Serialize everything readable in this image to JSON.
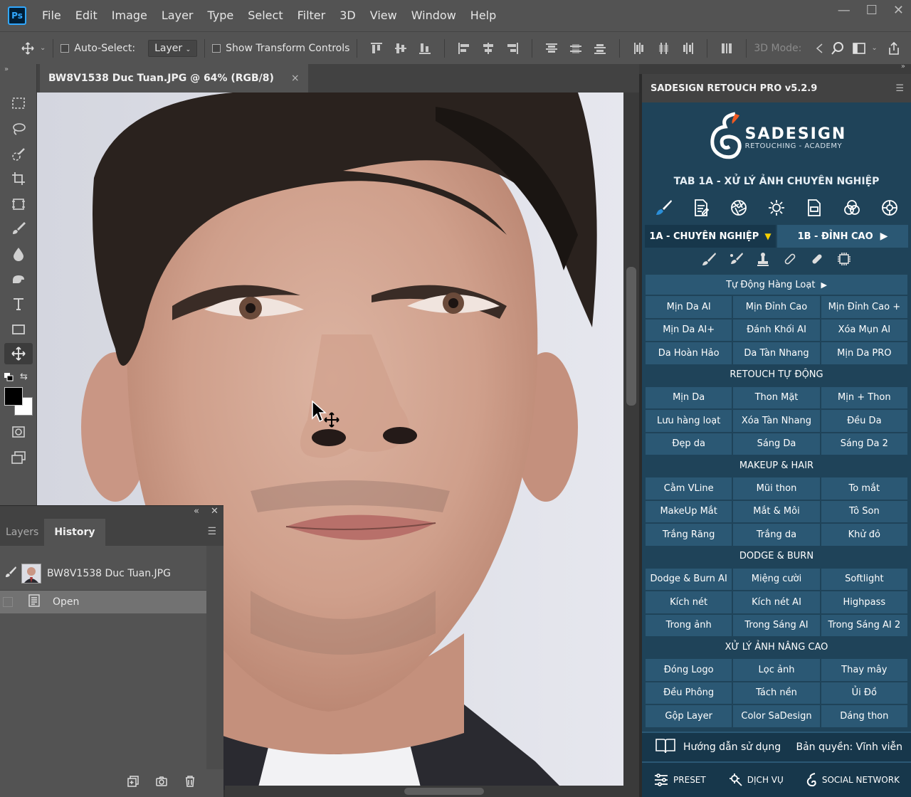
{
  "app": {
    "logo": "Ps"
  },
  "menu": [
    "File",
    "Edit",
    "Image",
    "Layer",
    "Type",
    "Select",
    "Filter",
    "3D",
    "View",
    "Window",
    "Help"
  ],
  "window_controls": {
    "minimize": "—",
    "restore": "☐",
    "close": "✕"
  },
  "options": {
    "auto_select_label": "Auto-Select:",
    "auto_select_value": "Layer",
    "show_transform_label": "Show Transform Controls",
    "mode_3d_label": "3D Mode:"
  },
  "document": {
    "tab_title": "BW8V1538 Duc Tuan.JPG @ 64% (RGB/8)",
    "close_glyph": "×"
  },
  "history_panel": {
    "tab_layers": "Layers",
    "tab_history": "History",
    "snapshot_name": "BW8V1538 Duc Tuan.JPG",
    "states": [
      "Open"
    ]
  },
  "plugin": {
    "header": "SADESIGN RETOUCH PRO v5.2.9",
    "brand_name": "SADESIGN",
    "brand_sub": "RETOUCHING - ACADEMY",
    "tab_title": "TAB 1A - XỬ LÝ ẢNH CHUYÊN NGHIỆP",
    "subtab_1": "1A - CHUYÊN NGHIỆP",
    "subtab_2": "1B - ĐỈNH CAO",
    "auto_batch": "Tự Động Hàng Loạt",
    "row_group_1": [
      "Mịn Da AI",
      "Mịn Đỉnh Cao",
      "Mịn Đỉnh Cao +",
      "Mịn Da AI+",
      "Đánh Khối AI",
      "Xóa Mụn AI",
      "Da Hoàn Hảo",
      "Da Tàn Nhang",
      "Mịn Da PRO"
    ],
    "section_1": "RETOUCH TỰ ĐỘNG",
    "row_group_2": [
      "Mịn Da",
      "Thon Mặt",
      "Mịn + Thon",
      "Lưu hàng loạt",
      "Xóa Tàn Nhang",
      "Đều Da",
      "Đẹp da",
      "Sáng Da",
      "Sáng Da 2"
    ],
    "section_2": "MAKEUP & HAIR",
    "row_group_3": [
      "Cằm VLine",
      "Mũi thon",
      "To mắt",
      "MakeUp Mắt",
      "Mắt & Môi",
      "Tô Son",
      "Trắng Răng",
      "Trắng da",
      "Khử đỏ"
    ],
    "section_3": "DODGE & BURN",
    "row_group_4": [
      "Dodge & Burn AI",
      "Miệng cười",
      "Softlight",
      "Kích nét",
      "Kích nét AI",
      "Highpass",
      "Trong ảnh",
      "Trong Sáng AI",
      "Trong Sáng AI 2"
    ],
    "section_4": "XỬ LÝ ẢNH NÂNG CAO",
    "row_group_5": [
      "Đóng Logo",
      "Lọc ảnh",
      "Thay mây",
      "Đều Phông",
      "Tách nền",
      "Ủi Đồ",
      "Gộp Layer",
      "Color SaDesign",
      "Dáng thon"
    ],
    "guide": "Hướng dẫn sử dụng",
    "license": "Bản quyền: Vĩnh viễn",
    "preset": "PRESET",
    "service": "DỊCH VỤ",
    "social": "SOCIAL NETWORK"
  },
  "colors": {
    "plugin_bg": "#1f4359",
    "plugin_button": "#2b5874",
    "accent_yellow": "#f5d000"
  }
}
